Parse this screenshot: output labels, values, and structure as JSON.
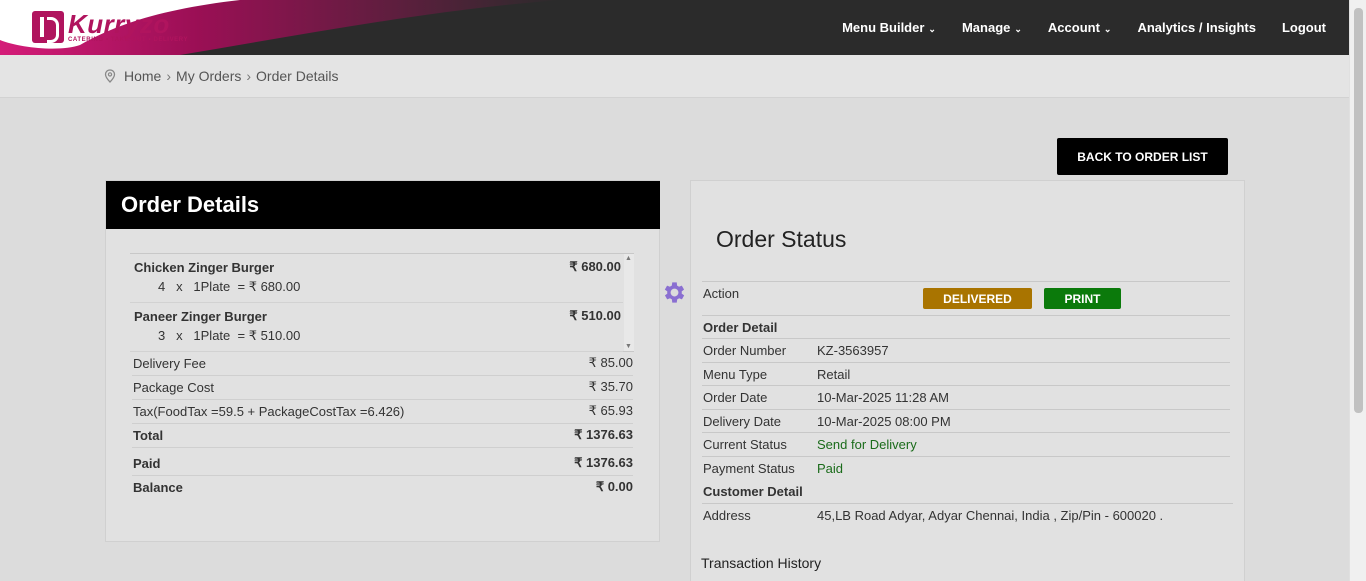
{
  "brand": {
    "name": "Kurryzo",
    "tagline": "CATERING • TAKE-OUT • DELIVERY",
    "color": "#b0145e"
  },
  "nav": [
    {
      "label": "Menu Builder",
      "caret": true
    },
    {
      "label": "Manage",
      "caret": true
    },
    {
      "label": "Account",
      "caret": true
    },
    {
      "label": "Analytics / Insights",
      "caret": false
    },
    {
      "label": "Logout",
      "caret": false
    }
  ],
  "breadcrumb": {
    "home": "Home",
    "orders": "My Orders",
    "current": "Order Details",
    "sep": "›"
  },
  "back_button": "BACK TO ORDER LIST",
  "order_details": {
    "title": "Order Details",
    "items": [
      {
        "name": "Chicken Zinger Burger",
        "calc": "4   x   1Plate  = ₹ 680.00",
        "price": "₹ 680.00"
      },
      {
        "name": "Paneer Zinger Burger",
        "calc": "3   x   1Plate  = ₹ 510.00",
        "price": "₹ 510.00"
      }
    ],
    "delivery_fee": {
      "label": "Delivery Fee",
      "value": "₹ 85.00"
    },
    "package_cost": {
      "label": "Package Cost",
      "value": "₹ 35.70"
    },
    "tax": {
      "label": "Tax(FoodTax =59.5 + PackageCostTax =6.426)",
      "value": "₹ 65.93"
    },
    "total": {
      "label": "Total",
      "value": "₹ 1376.63"
    },
    "paid": {
      "label": "Paid",
      "value": "₹ 1376.63"
    },
    "balance": {
      "label": "Balance",
      "value": "₹ 0.00"
    }
  },
  "order_status": {
    "title": "Order Status",
    "action_label": "Action",
    "delivered_btn": "DELIVERED",
    "print_btn": "PRINT",
    "order_detail_heading": "Order Detail",
    "order_number": {
      "label": "Order Number",
      "value": "KZ-3563957"
    },
    "menu_type": {
      "label": "Menu Type",
      "value": "Retail"
    },
    "order_date": {
      "label": "Order Date",
      "value": "10-Mar-2025 11:28 AM"
    },
    "delivery_date": {
      "label": "Delivery Date",
      "value": "10-Mar-2025 08:00 PM"
    },
    "current_status": {
      "label": "Current Status",
      "value": "Send for Delivery"
    },
    "payment_status": {
      "label": "Payment Status",
      "value": "Paid"
    },
    "customer_detail_heading": "Customer Detail",
    "address": {
      "label": "Address",
      "value": "45,LB Road Adyar, Adyar Chennai, India , Zip/Pin - 600020 ."
    },
    "transaction_history": "Transaction History"
  }
}
